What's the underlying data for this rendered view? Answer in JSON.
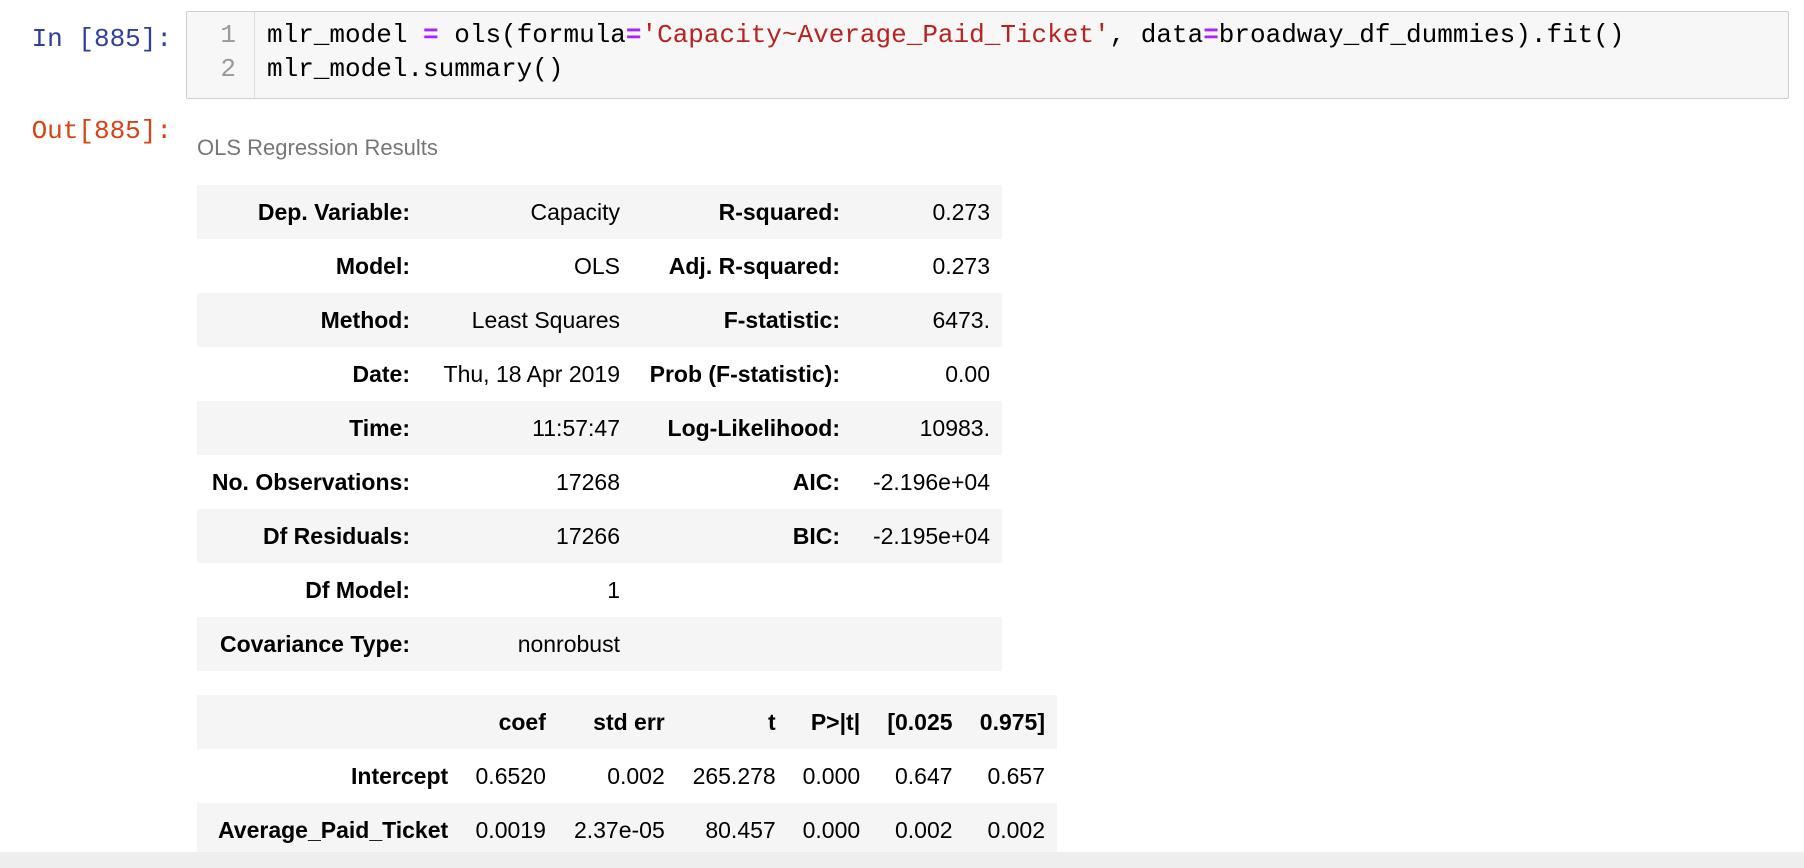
{
  "input_cell": {
    "prompt": "In [885]:",
    "line_numbers": [
      "1",
      "2"
    ],
    "line1": {
      "a": "mlr_model ",
      "op1": "=",
      "b": " ols(formula",
      "op2": "=",
      "str": "'Capacity~Average_Paid_Ticket'",
      "c": ", data",
      "op3": "=",
      "d": "broadway_df_dummies).fit()"
    },
    "line2": "mlr_model.summary()"
  },
  "output_cell": {
    "prompt": "Out[885]:",
    "caption": "OLS Regression Results"
  },
  "summary_table": [
    {
      "label": "Dep. Variable:",
      "value": "Capacity",
      "label2": "R-squared:",
      "value2": "0.273"
    },
    {
      "label": "Model:",
      "value": "OLS",
      "label2": "Adj. R-squared:",
      "value2": "0.273"
    },
    {
      "label": "Method:",
      "value": "Least Squares",
      "label2": "F-statistic:",
      "value2": "6473."
    },
    {
      "label": "Date:",
      "value": "Thu, 18 Apr 2019",
      "label2": "Prob (F-statistic):",
      "value2": "0.00"
    },
    {
      "label": "Time:",
      "value": "11:57:47",
      "label2": "Log-Likelihood:",
      "value2": "10983."
    },
    {
      "label": "No. Observations:",
      "value": "17268",
      "label2": "AIC:",
      "value2": "-2.196e+04"
    },
    {
      "label": "Df Residuals:",
      "value": "17266",
      "label2": "BIC:",
      "value2": "-2.195e+04"
    },
    {
      "label": "Df Model:",
      "value": "1",
      "label2": "",
      "value2": ""
    },
    {
      "label": "Covariance Type:",
      "value": "nonrobust",
      "label2": "",
      "value2": ""
    }
  ],
  "coef_table": {
    "headers": [
      "",
      "coef",
      "std err",
      "t",
      "P>|t|",
      "[0.025",
      "0.975]"
    ],
    "rows": [
      {
        "name": "Intercept",
        "coef": "0.6520",
        "std_err": "0.002",
        "t": "265.278",
        "p": "0.000",
        "lo": "0.647",
        "hi": "0.657"
      },
      {
        "name": "Average_Paid_Ticket",
        "coef": "0.0019",
        "std_err": "2.37e-05",
        "t": "80.457",
        "p": "0.000",
        "lo": "0.002",
        "hi": "0.002"
      }
    ]
  },
  "colors": {
    "in_prompt": "#303f9f",
    "out_prompt": "#d84315",
    "operator": "#aa22ff",
    "string": "#ba2121",
    "row_stripe": "#f5f5f5"
  }
}
